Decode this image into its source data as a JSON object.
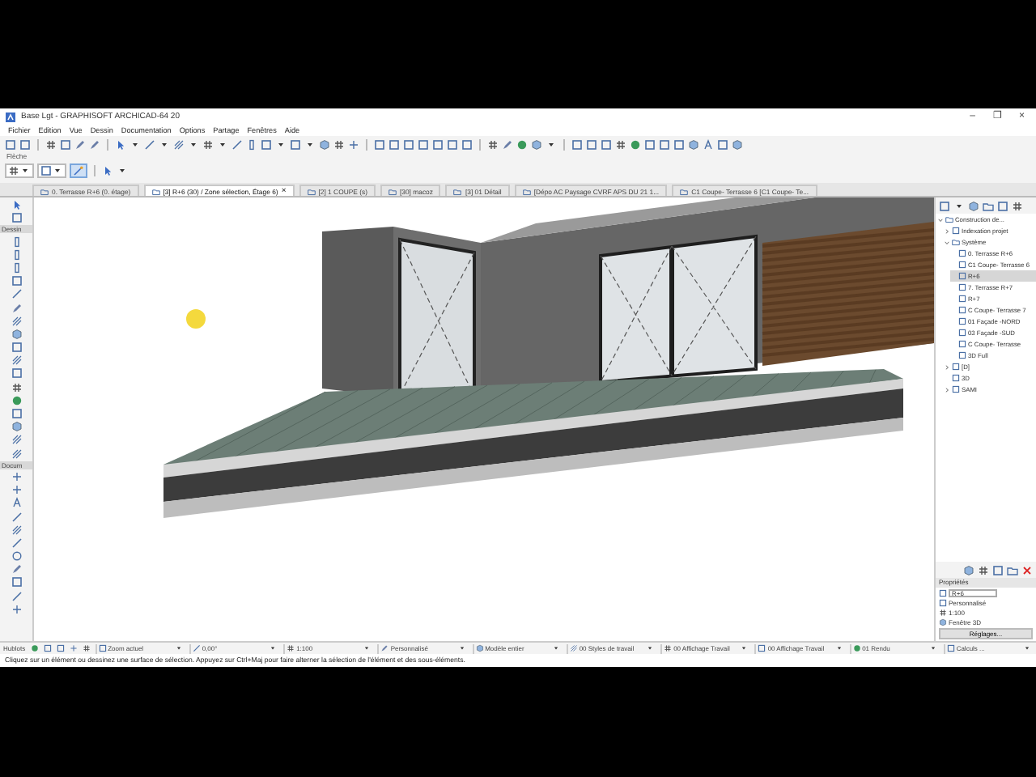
{
  "window": {
    "title": "Base Lgt - GRAPHISOFT ARCHICAD-64 20",
    "controls": [
      "–",
      "❐",
      "×"
    ]
  },
  "menu": [
    "Fichier",
    "Edition",
    "Vue",
    "Dessin",
    "Documentation",
    "Options",
    "Partage",
    "Fenêtres",
    "Aide"
  ],
  "toolbar_label": "Flèche",
  "tabs": [
    {
      "label": "0. Terrasse R+6 (0. étage)",
      "selected": false
    },
    {
      "label": "[3] R+6 (30) / Zone sélection, Étage 6)",
      "selected": true,
      "close": "×"
    },
    {
      "label": "[2] 1 COUPE (s)",
      "selected": false
    },
    {
      "label": "[30] macoz",
      "selected": false
    },
    {
      "label": "[3] 01 Détail",
      "selected": false
    },
    {
      "label": "[Dépo AC Paysage CVRF APS DU 21 1...",
      "selected": false
    },
    {
      "label": "C1 Coupe- Terrasse 6 [C1 Coupe- Te...",
      "selected": false
    }
  ],
  "toolbox": {
    "groups": [
      {
        "label": "Dessin"
      },
      {
        "label": "Docum"
      }
    ]
  },
  "navigator": {
    "tree": [
      {
        "label": "Construction de...",
        "expanded": true,
        "selected": false,
        "children": [
          {
            "label": "Indexation projet",
            "expanded": false,
            "selected": false
          },
          {
            "label": "Système",
            "expanded": true,
            "selected": false,
            "children": [
              {
                "label": "0. Terrasse R+6",
                "selected": false
              },
              {
                "label": "C1 Coupe- Terrasse 6",
                "selected": false
              },
              {
                "label": "R+6",
                "selected": true
              },
              {
                "label": "7. Terrasse R+7",
                "selected": false
              },
              {
                "label": "R+7",
                "selected": false
              },
              {
                "label": "C Coupe- Terrasse 7",
                "selected": false
              },
              {
                "label": "01 Façade -NORD",
                "selected": false
              },
              {
                "label": "03 Façade -SUD",
                "selected": false
              },
              {
                "label": "C Coupe- Terrasse",
                "selected": false
              },
              {
                "label": "3D Full",
                "selected": false
              }
            ]
          },
          {
            "label": "[D]",
            "expanded": false,
            "selected": false
          },
          {
            "label": "3D",
            "selected": false
          },
          {
            "label": "SAMI",
            "expanded": false,
            "selected": false
          }
        ]
      }
    ]
  },
  "properties": {
    "title": "Propriétés",
    "id_value": "R+6",
    "items": [
      "Personnalisé",
      "1:100",
      "Fenêtre 3D"
    ],
    "button": "Réglages..."
  },
  "bottom_bar": {
    "label": "Hublots",
    "fields": [
      "Zoom actuel",
      "0,00°",
      "1:100",
      "Personnalisé",
      "Modèle entier",
      "00 Styles de travail",
      "00 Affichage Travail",
      "00 Affichage Travail",
      "01 Rendu",
      "Calculs ..."
    ]
  },
  "status_bar": "Cliquez sur un élément ou dessinez une surface de sélection. Appuyez sur Ctrl+Maj pour faire alterner la sélection de l'élément et des sous-éléments."
}
